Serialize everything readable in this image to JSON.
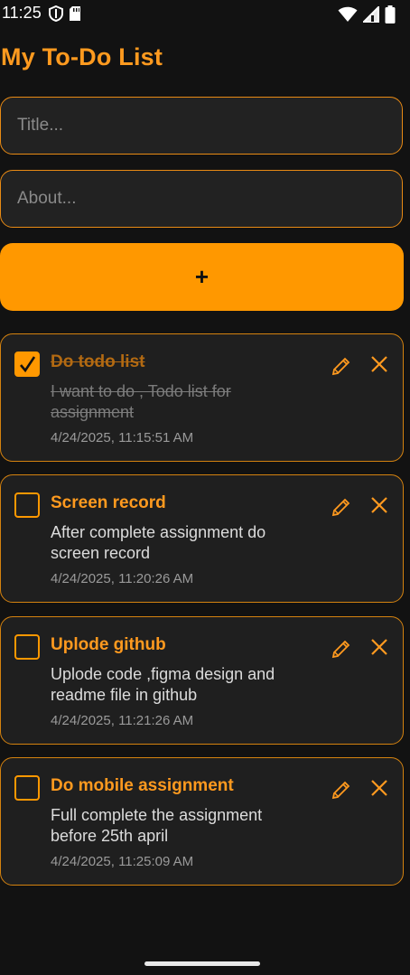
{
  "status_bar": {
    "time": "11:25",
    "icons": [
      "shield-icon",
      "sd-card-icon",
      "wifi-icon",
      "signal-icon",
      "battery-icon"
    ]
  },
  "app": {
    "title": "My To-Do List"
  },
  "form": {
    "title_placeholder": "Title...",
    "about_placeholder": "About...",
    "add_label": "+"
  },
  "tasks": [
    {
      "title": "Do todo list",
      "description": "I want to do , Todo list for assignment",
      "date": "4/24/2025, 11:15:51 AM",
      "completed": true
    },
    {
      "title": "Screen record",
      "description": "After complete assignment do screen record",
      "date": "4/24/2025, 11:20:26 AM",
      "completed": false
    },
    {
      "title": "Uplode github",
      "description": "Uplode code ,figma design and readme file in github",
      "date": "4/24/2025, 11:21:26 AM",
      "completed": false
    },
    {
      "title": "Do mobile assignment",
      "description": "Full complete the assignment before 25th april",
      "date": "4/24/2025, 11:25:09 AM",
      "completed": false
    }
  ],
  "colors": {
    "accent": "#ff9800",
    "background": "#121212",
    "card": "#1f1f1f"
  }
}
